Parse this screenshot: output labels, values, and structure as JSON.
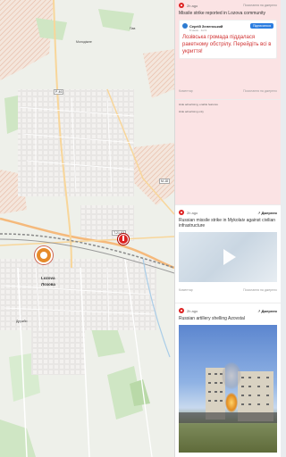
{
  "map": {
    "labels": {
      "pavlivka": "Пав",
      "molodizhne": "Молодіжне",
      "lozova_en": "Lozova",
      "lozova_ua": "Лозова",
      "druzhba": "Дружби",
      "p46": "P-46",
      "e105": "M-18",
      "road_t1": "T-21-03"
    }
  },
  "feed": {
    "cards": [
      {
        "time_ago": "2h ago",
        "link_label": "Посилання на джерело",
        "title": "Missile strike reported in Lozova community",
        "telegram": {
          "name": "Сергій Зеленський",
          "sub": "6 views · Jul 3",
          "button": "Підписатися",
          "text": "Лозівська громада піддалася ракетному обстрілу. Перейдіть всі в укриття!"
        },
        "footer_left": "Коментар",
        "footer_right": "Посилання на джерело"
      },
      {
        "ad_label_1": "Hide advertising, enable features",
        "ad_label_2": "Hide advertising only"
      },
      {
        "time_ago": "2h ago",
        "link_label": "Джерело",
        "title": "Russian missile strike in Mykolaiv against civilian infrastructure",
        "footer_left": "Коментар",
        "footer_right": "Посилання на джерело"
      },
      {
        "time_ago": "2h ago",
        "link_label": "Джерело",
        "title": "Russian artillery shelling Azovstal"
      }
    ]
  },
  "colors": {
    "accent": "#d22222",
    "alert_bg": "#fbe3e4",
    "telegram": "#2b7de0"
  }
}
